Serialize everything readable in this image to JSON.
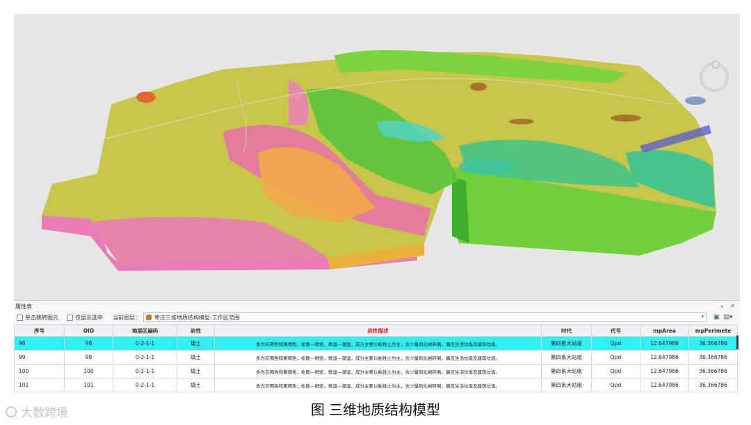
{
  "panel": {
    "title": "属性表",
    "controls": "⌅ ✕"
  },
  "toolbar": {
    "check_flash": "单击跳转图元",
    "check_selected": "仅显示选中",
    "layer_label": "当前图层：",
    "layer_value": "枣庄三维地质结构模型-工作区范围"
  },
  "table": {
    "headers": [
      "序号",
      "OID",
      "地层区编码",
      "岩性",
      "岩性描述",
      "时代",
      "代号",
      "mpArea",
      "mpPerimete"
    ],
    "rows": [
      [
        "98",
        "98",
        "0-2-1-1",
        "填土",
        "多为灰褐色和黄褐色，松散—稍密，稍湿—潮湿，成分主要以粘性土为主，含少量风化岩碎屑，偶见生活垃圾及建筑垃圾。",
        "第四系大站组",
        "Qpd",
        "12.647986",
        "36.366786"
      ],
      [
        "99",
        "99",
        "0-2-1-1",
        "填土",
        "多为灰褐色和黄褐色，松散—稍密，稍湿—潮湿，成分主要以粘性土为主，含少量风化岩碎屑，偶见生活垃圾及建筑垃圾。",
        "第四系大站组",
        "Qpd",
        "12.647986",
        "36.366786"
      ],
      [
        "100",
        "100",
        "0-2-1-1",
        "填土",
        "多为灰褐色和黄褐色，松散—稍密，稍湿—潮湿，成分主要以粘性土为主，含少量风化岩碎屑，偶见生活垃圾及建筑垃圾。",
        "第四系大站组",
        "Qpd",
        "12.647986",
        "36.366786"
      ],
      [
        "101",
        "101",
        "0-2-1-1",
        "填土",
        "多为灰褐色和黄褐色，松散—稍密，稍湿—潮湿，成分主要以粘性土为主，含少量风化岩碎屑，偶见生活垃圾及建筑垃圾。",
        "第四系大站组",
        "Qpd",
        "12.647986",
        "36.366786"
      ]
    ],
    "selected_index": 0
  },
  "caption": "图  三维地质结构模型",
  "watermark": "大数跨境",
  "colors": {
    "selected_row": "#33eef0",
    "header_highlight": "#e02020",
    "terrain_base": "#c8c64a",
    "pink_layer": "#e87cb5",
    "green_layer": "#7fd63a"
  }
}
